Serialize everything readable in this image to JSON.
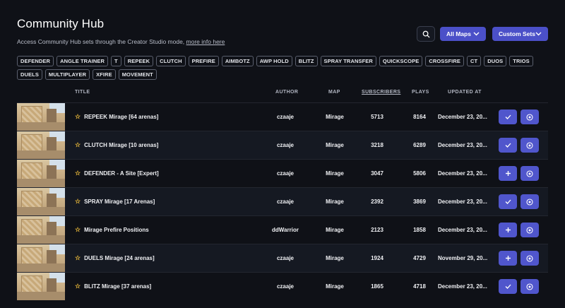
{
  "header": {
    "title": "Community Hub",
    "subtitle": "Access Community Hub sets through the Creator Studio mode,",
    "more_info_link": "more info here"
  },
  "toolbar": {
    "maps_dropdown": "All Maps",
    "sets_dropdown": "Custom Sets"
  },
  "tags": [
    "DEFENDER",
    "ANGLE TRAINER",
    "T",
    "REPEEK",
    "CLUTCH",
    "PREFIRE",
    "AIMBOTZ",
    "AWP HOLD",
    "BLITZ",
    "SPRAY TRANSFER",
    "QUICKSCOPE",
    "CROSSFIRE",
    "CT",
    "DUOS",
    "TRIOS",
    "DUELS",
    "MULTIPLAYER",
    "XFIRE",
    "MOVEMENT"
  ],
  "table": {
    "headers": {
      "title": "TITLE",
      "author": "AUTHOR",
      "map": "MAP",
      "subscribers": "SUBSCRIBERS",
      "plays": "PLAYS",
      "updated": "UPDATED AT"
    },
    "rows": [
      {
        "title": "REPEEK Mirage [64 arenas]",
        "author": "czaaje",
        "map": "Mirage",
        "subscribers": "5713",
        "plays": "8164",
        "updated": "December 23, 20...",
        "action": "check"
      },
      {
        "title": "CLUTCH Mirage [10 arenas]",
        "author": "czaaje",
        "map": "Mirage",
        "subscribers": "3218",
        "plays": "6289",
        "updated": "December 23, 20...",
        "action": "check"
      },
      {
        "title": "DEFENDER - A Site [Expert]",
        "author": "czaaje",
        "map": "Mirage",
        "subscribers": "3047",
        "plays": "5806",
        "updated": "December 23, 20...",
        "action": "plus"
      },
      {
        "title": "SPRAY Mirage [17 Arenas]",
        "author": "czaaje",
        "map": "Mirage",
        "subscribers": "2392",
        "plays": "3869",
        "updated": "December 23, 20...",
        "action": "check"
      },
      {
        "title": "Mirage Prefire Positions",
        "author": "ddWarrior",
        "map": "Mirage",
        "subscribers": "2123",
        "plays": "1858",
        "updated": "December 23, 20...",
        "action": "plus"
      },
      {
        "title": "DUELS Mirage [24 arenas]",
        "author": "czaaje",
        "map": "Mirage",
        "subscribers": "1924",
        "plays": "4729",
        "updated": "November 29, 20...",
        "action": "plus"
      },
      {
        "title": "BLITZ Mirage [37 arenas]",
        "author": "czaaje",
        "map": "Mirage",
        "subscribers": "1865",
        "plays": "4718",
        "updated": "December 23, 20...",
        "action": "check"
      }
    ]
  },
  "icons": {
    "search": "search-icon",
    "chevron": "chevron-down-icon",
    "star": "star-icon",
    "check": "check-icon",
    "plus": "plus-icon",
    "play": "play-circle-icon"
  }
}
